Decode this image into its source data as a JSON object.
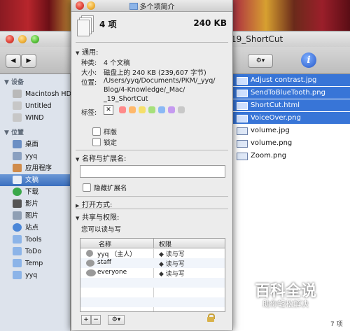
{
  "finder": {
    "title": "19_ShortCut",
    "nav_back": "◀",
    "nav_fwd": "▶",
    "action_icon": "gear-icon",
    "info_icon": "i",
    "status_right": "7 项",
    "sidebar": {
      "devices_header": "▼ 设备",
      "devices": [
        "Macintosh HD",
        "Untitled",
        "WIND"
      ],
      "places_header": "▼ 位置",
      "places": [
        "桌面",
        "yyq",
        "应用程序",
        "文稿",
        "下载",
        "影片",
        "图片",
        "站点",
        "Tools",
        "ToDo",
        "Temp",
        "yyq"
      ],
      "selected_index": 3
    },
    "files": [
      {
        "name": "Adjust contrast.jpg",
        "selected": true
      },
      {
        "name": "SendToBlueTooth.png",
        "selected": true
      },
      {
        "name": "ShortCut.html",
        "selected": true
      },
      {
        "name": "VoiceOver.png",
        "selected": true
      },
      {
        "name": "volume.jpg",
        "selected": false
      },
      {
        "name": "volume.png",
        "selected": false
      },
      {
        "name": "Zoom.png",
        "selected": false
      }
    ]
  },
  "info": {
    "title": "多个项简介",
    "count": "4 项",
    "size": "240 KB",
    "general": {
      "header": "通用:",
      "kind_label": "种类:",
      "kind_value": "4 个文稿",
      "size_label": "大小:",
      "size_value": "磁盘上的 240 KB (239,607 字节)",
      "where_label": "位置:",
      "where_value_1": "/Users/yyq/Documents/PKM/_yyq/",
      "where_value_2": "Blog/4-Knowledge/_Mac/",
      "where_value_3": "_19_ShortCut",
      "tags_label": "标签:",
      "tag_clear": "✕",
      "tag_colors": [
        "#ff8a8a",
        "#ffb86b",
        "#f6df6a",
        "#a6e07b",
        "#8ab8f5",
        "#c59af0",
        "#c8c8c8"
      ],
      "stationery": "样版",
      "locked": "锁定"
    },
    "name_ext": {
      "header": "名称与扩展名:",
      "hide_ext": "隐藏扩展名"
    },
    "open_with": {
      "header": "打开方式:"
    },
    "sharing": {
      "header": "共享与权限:",
      "summary": "您可以读与写",
      "col_name": "名称",
      "col_priv": "权限",
      "rows": [
        {
          "name": "yyq （主人）",
          "priv": "读与写"
        },
        {
          "name": "staff",
          "priv": "读与写"
        },
        {
          "name": "everyone",
          "priv": "读与写"
        }
      ]
    },
    "footer": {
      "add": "+",
      "remove": "−",
      "action": "⚙▾"
    }
  },
  "watermark": {
    "title": "百科全说",
    "subtitle": "助你轻松解决"
  }
}
